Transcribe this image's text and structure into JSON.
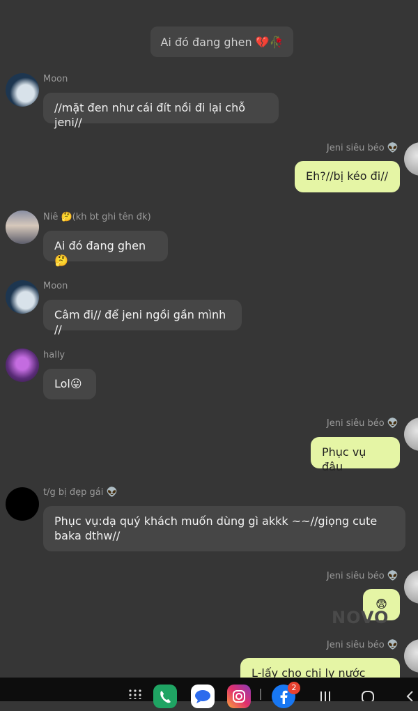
{
  "system_message": "Ai đó đang ghen 💔🥀",
  "messages": [
    {
      "sender": "Moon",
      "text": "//mặt đen như cái đít nồi đi lại chỗ jeni//"
    },
    {
      "sender": "Jeni siêu béo 👽",
      "text": "Eh?//bị kéo đi//"
    },
    {
      "sender": "Niê 🤔(kh bt ghi tên đk)",
      "text": "Ai đó đang ghen🤔"
    },
    {
      "sender": "Moon",
      "text": "Câm đi// để jeni ngồi gần mình //"
    },
    {
      "sender": "hally",
      "text": "Lol😛"
    },
    {
      "sender": "Jeni siêu béo 👽",
      "text": "Phục vụ đâu"
    },
    {
      "sender": "t/g bị đẹp gái 👽",
      "text": "Phục vụ:dạ quý khách muốn dùng gì akkk ~~//giọng cute baka dthw//"
    },
    {
      "sender": "Jeni siêu béo 👽",
      "text": "😨"
    },
    {
      "sender": "Jeni siêu béo 👽",
      "text": "L-lấy cho chị ly nước lọc..."
    }
  ],
  "watermark": "NOVO",
  "navbar": {
    "facebook_badge": "2"
  },
  "colors": {
    "background": "#363636",
    "incoming_bubble": "#464646",
    "outgoing_bubble": "#e5f5a5",
    "navbar": "#0d0d0d"
  }
}
